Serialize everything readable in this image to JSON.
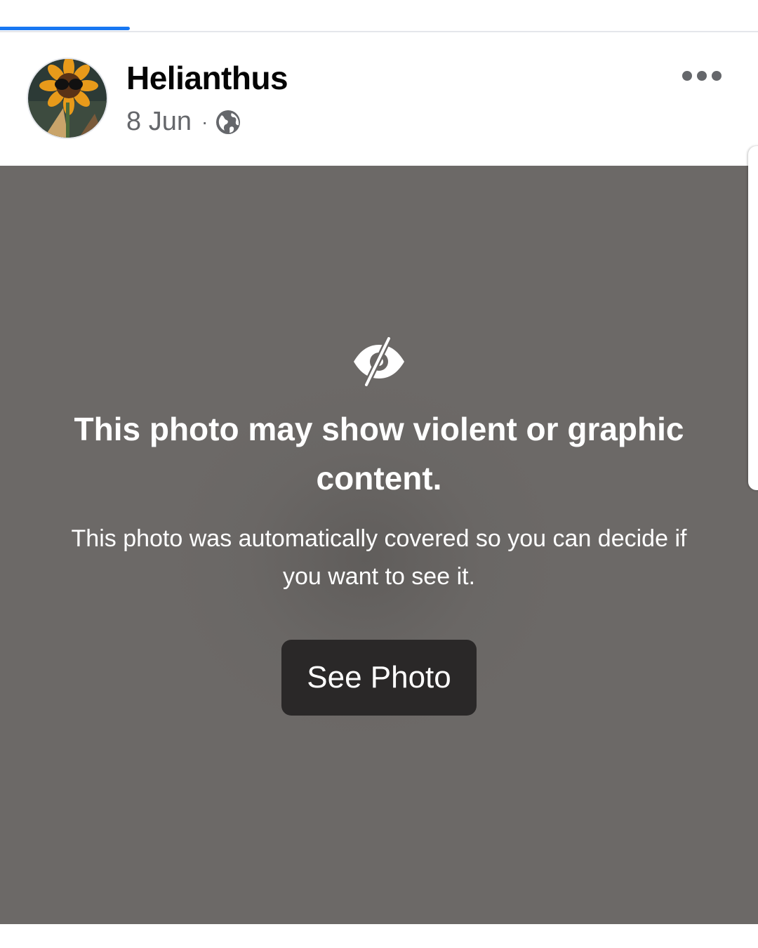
{
  "post": {
    "author": "Helianthus",
    "date": "8 Jun",
    "separator": "·",
    "audience_icon": "globe-icon",
    "menu_icon": "more-options-icon"
  },
  "content_warning": {
    "icon": "eye-slash-icon",
    "title": "This photo may show violent or graphic content.",
    "subtitle": "This photo was automatically covered so you can decide if you want to see it.",
    "button_label": "See Photo"
  },
  "colors": {
    "accent": "#1877f2",
    "cover_background": "#6b6866",
    "button_background": "#2a2828"
  }
}
